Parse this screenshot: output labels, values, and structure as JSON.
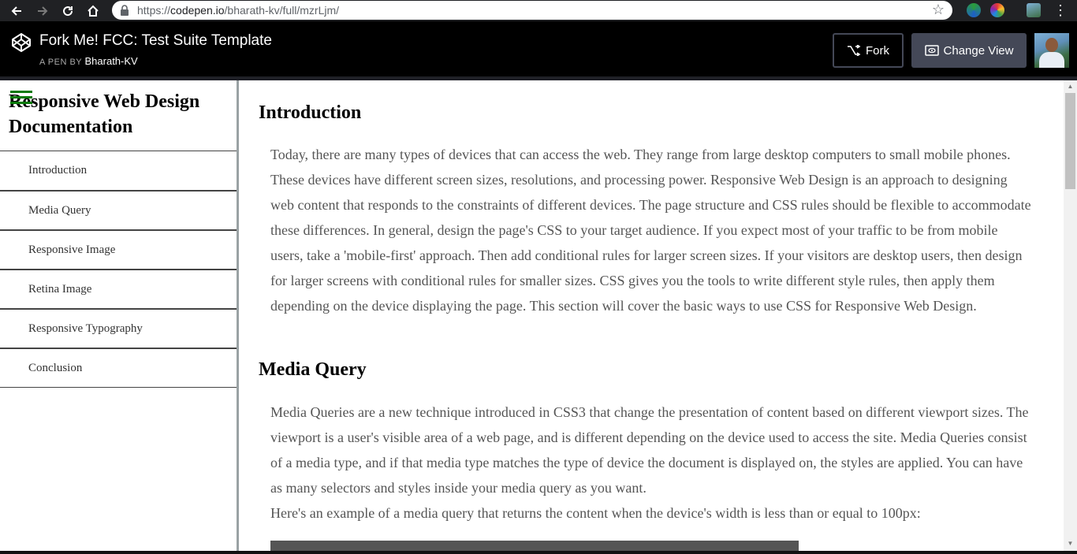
{
  "browser": {
    "url_prefix": "https://",
    "url_host": "codepen.io",
    "url_path": "/bharath-kv/full/mzrLjm/"
  },
  "codepen": {
    "title": "Fork Me! FCC: Test Suite Template",
    "byline_prefix": "A PEN BY",
    "author": "Bharath-KV",
    "fork_label": "Fork",
    "change_view_label": "Change View"
  },
  "sidebar": {
    "title": "Responsive Web Design Documentation",
    "items": [
      {
        "label": "Introduction"
      },
      {
        "label": "Media Query"
      },
      {
        "label": "Responsive Image"
      },
      {
        "label": "Retina Image"
      },
      {
        "label": "Responsive Typography"
      },
      {
        "label": "Conclusion"
      }
    ]
  },
  "main": {
    "sections": [
      {
        "title": "Introduction",
        "paragraphs": [
          "Today, there are many types of devices that can access the web. They range from large desktop computers to small mobile phones. These devices have different screen sizes, resolutions, and processing power. Responsive Web Design is an approach to designing web content that responds to the constraints of different devices. The page structure and CSS rules should be flexible to accommodate these differences. In general, design the page's CSS to your target audience. If you expect most of your traffic to be from mobile users, take a 'mobile-first' approach. Then add conditional rules for larger screen sizes. If your visitors are desktop users, then design for larger screens with conditional rules for smaller sizes. CSS gives you the tools to write different style rules, then apply them depending on the device displaying the page. This section will cover the basic ways to use CSS for Responsive Web Design."
        ]
      },
      {
        "title": "Media Query",
        "paragraphs": [
          "Media Queries are a new technique introduced in CSS3 that change the presentation of content based on different viewport sizes. The viewport is a user's visible area of a web page, and is different depending on the device used to access the site. Media Queries consist of a media type, and if that media type matches the type of device the document is displayed on, the styles are applied. You can have as many selectors and styles inside your media query as you want.",
          "Here's an example of a media query that returns the content when the device's width is less than or equal to 100px:"
        ]
      }
    ]
  },
  "colors": {
    "hamburger": "#0a7a0a",
    "paragraph_text": "#555555",
    "codepen_header": "#000000",
    "change_view_button": "#444857"
  }
}
